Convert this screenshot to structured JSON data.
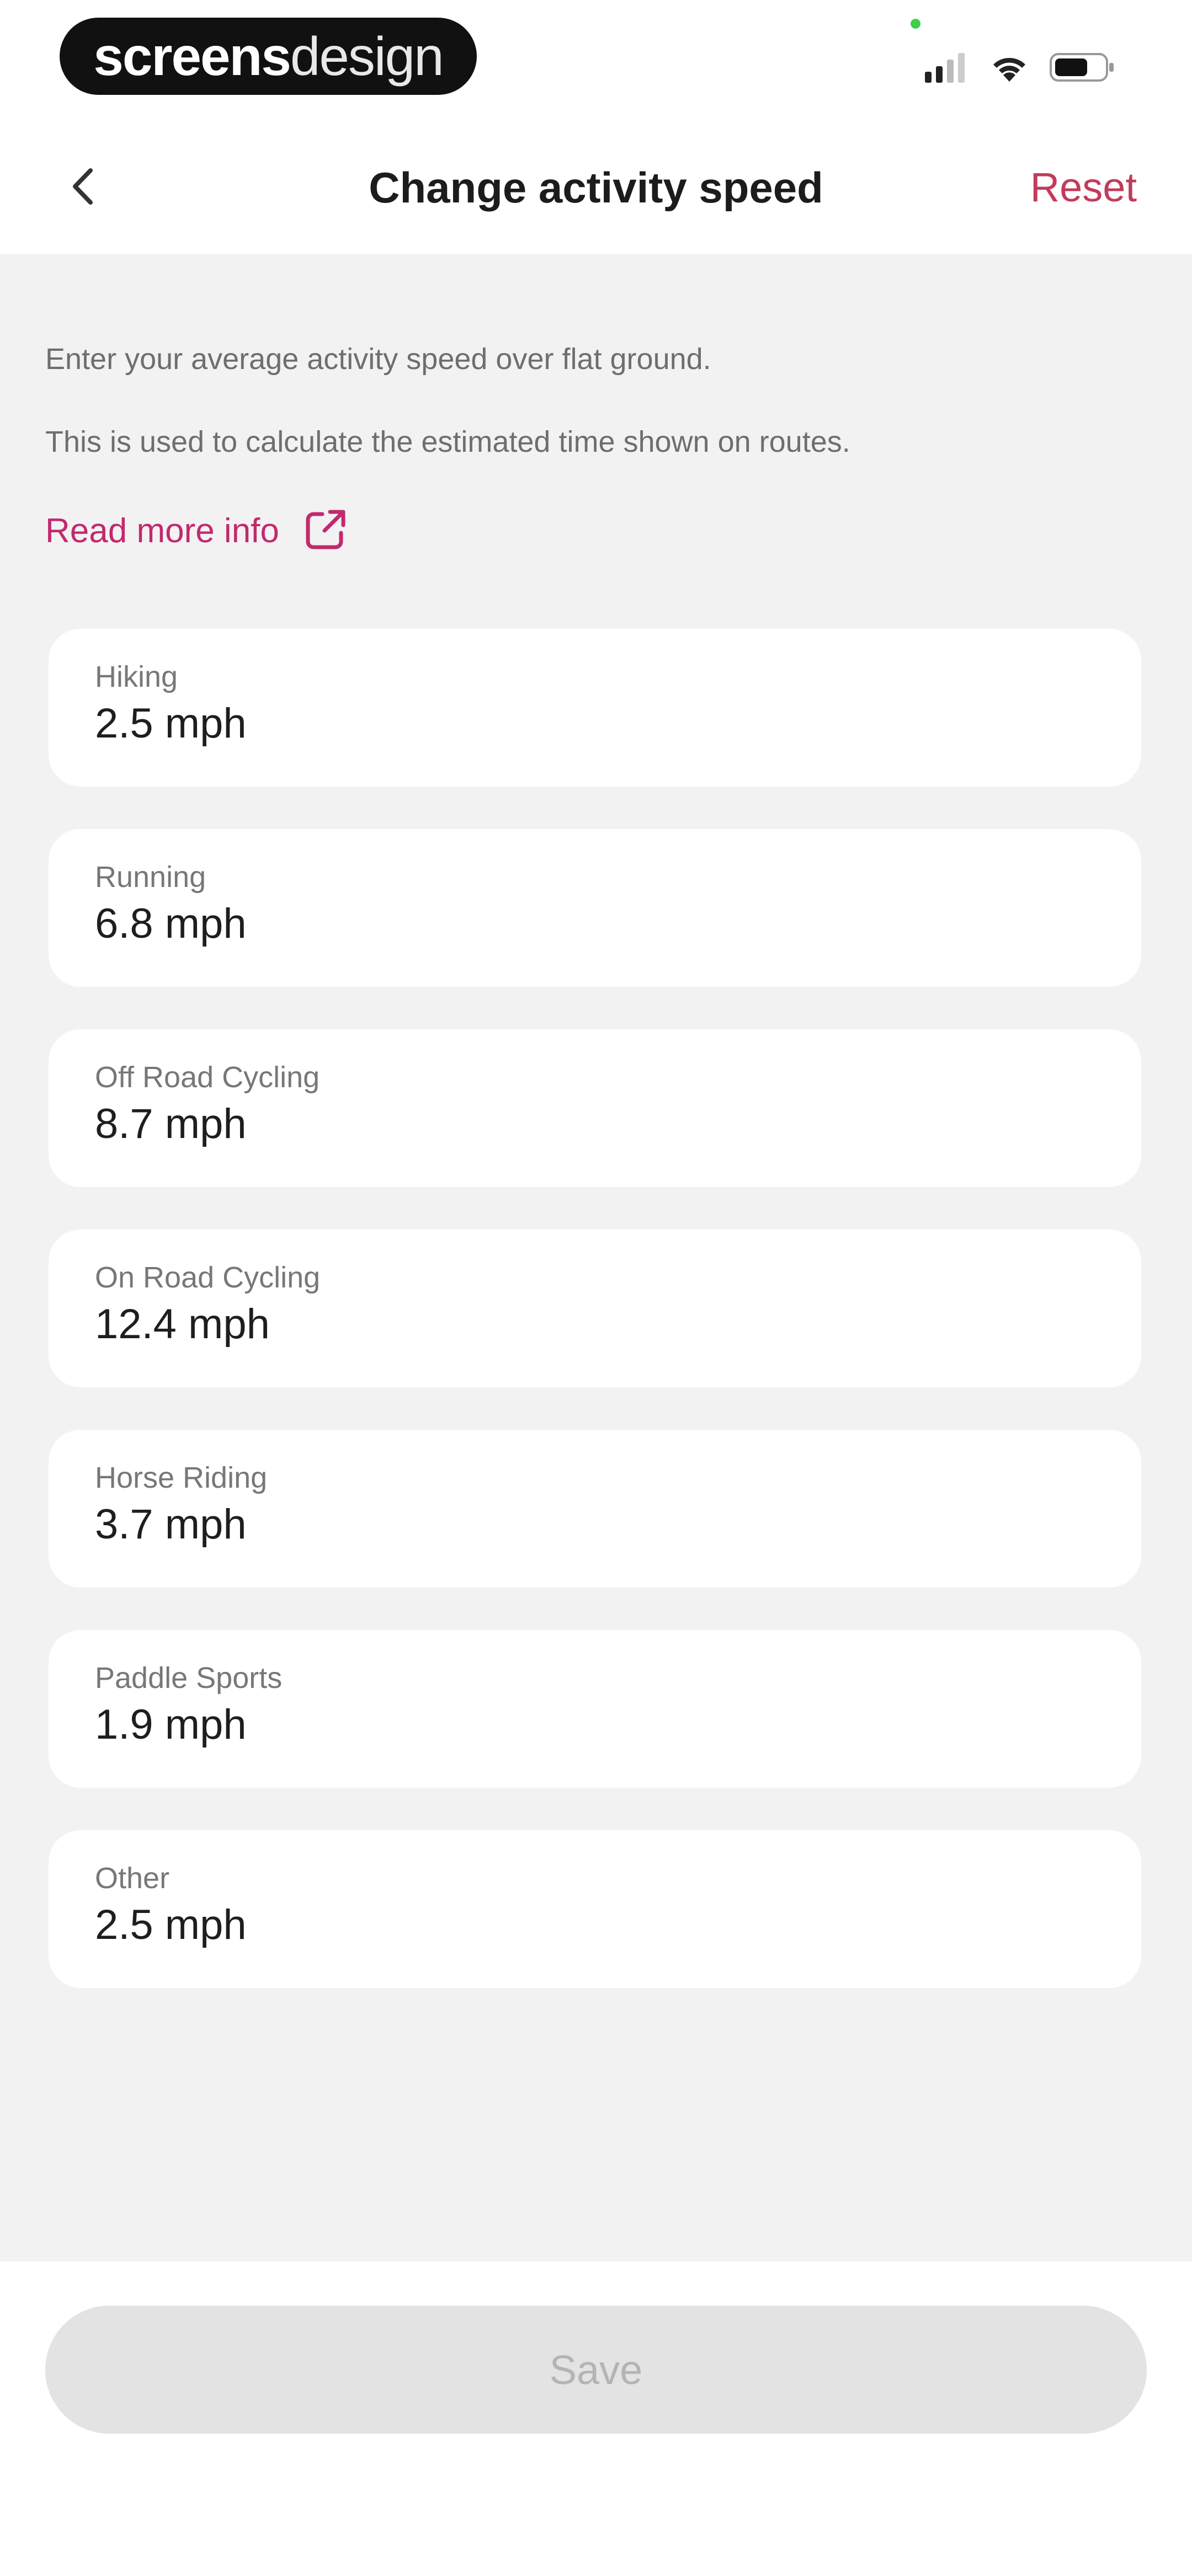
{
  "status_bar": {
    "brand": {
      "part1": "screens",
      "part2": "design"
    },
    "icons": [
      "cellular-signal-icon",
      "wifi-icon",
      "battery-icon"
    ],
    "indicator_color": "#3fcf4a"
  },
  "header": {
    "back_icon": "chevron-left-icon",
    "title": "Change activity speed",
    "reset_label": "Reset"
  },
  "intro": {
    "line1": "Enter your average activity speed over flat ground.",
    "line2": "This is used to calculate the estimated time shown on routes.",
    "read_more_label": "Read more info",
    "read_more_icon": "external-link-icon"
  },
  "activities": [
    {
      "label": "Hiking",
      "value": "2.5 mph"
    },
    {
      "label": "Running",
      "value": "6.8 mph"
    },
    {
      "label": "Off Road Cycling",
      "value": "8.7 mph"
    },
    {
      "label": "On Road Cycling",
      "value": "12.4 mph"
    },
    {
      "label": "Horse Riding",
      "value": "3.7 mph"
    },
    {
      "label": "Paddle Sports",
      "value": "1.9 mph"
    },
    {
      "label": "Other",
      "value": "2.5 mph"
    }
  ],
  "footer": {
    "save_label": "Save"
  },
  "colors": {
    "accent_pink": "#c2296e",
    "reset_red": "#c23b5a",
    "background_grey": "#f2f2f2",
    "disabled_button": "#e3e3e3"
  }
}
